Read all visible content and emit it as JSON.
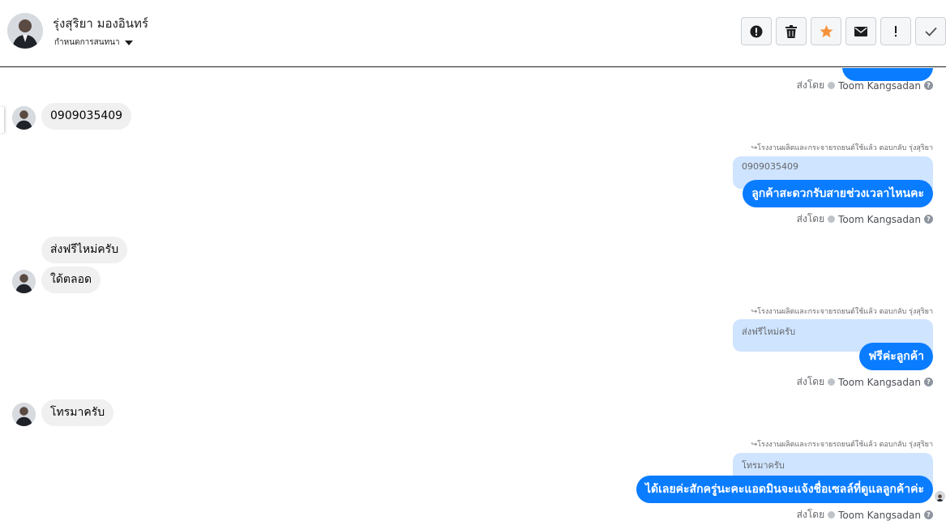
{
  "header": {
    "contact_name": "รุ่งสุริยา มองอินทร์",
    "convo_dropdown_label": "กำหนดการสนทนา",
    "toolbar": [
      {
        "icon": "alert-circle-icon",
        "name": "mark-spam-button"
      },
      {
        "icon": "trash-icon",
        "name": "delete-button"
      },
      {
        "icon": "star-icon",
        "name": "star-button",
        "color": "#f7923b"
      },
      {
        "icon": "envelope-icon",
        "name": "mark-unread-button"
      },
      {
        "icon": "exclamation-icon",
        "name": "important-button"
      },
      {
        "icon": "checkmark-icon",
        "name": "mark-done-button"
      }
    ]
  },
  "colors": {
    "outgoing_bubble": "#0a7cff",
    "incoming_bubble": "#f0f0f0",
    "quoted_bubble": "#cfe4ff"
  },
  "sent_by": {
    "prefix": "ส่งโดย",
    "agent": "Toom Kangsadan"
  },
  "messages": [
    {
      "direction": "incoming",
      "text": "0909035409"
    },
    {
      "direction": "outgoing",
      "reply_note": "โรงงานผลิตและกระจายรถยนต์ใช้แล้ว ตอบกลับ รุ่งสุริยา",
      "quoted": "0909035409",
      "text": "ลูกค้าสะดวกรับสายช่วงเวลาไหนคะ"
    },
    {
      "direction": "incoming",
      "text": "ส่งฟรีไหม่ครับ"
    },
    {
      "direction": "incoming",
      "text": "ใด้ตลอด"
    },
    {
      "direction": "outgoing",
      "reply_note": "โรงงานผลิตและกระจายรถยนต์ใช้แล้ว ตอบกลับ รุ่งสุริยา",
      "quoted": "ส่งฟรีไหม่ครับ",
      "text": "ฟรีค่ะลูกค้า"
    },
    {
      "direction": "incoming",
      "text": "โทรมาครับ"
    },
    {
      "direction": "outgoing",
      "reply_note": "โรงงานผลิตและกระจายรถยนต์ใช้แล้ว ตอบกลับ รุ่งสุริยา",
      "quoted": "โทรมาครับ",
      "text": "ได้เลยค่ะสักครู่นะคะแอดมินจะแจ้งชื่อเซลล์ที่ดูแลลูกค้าค่ะ"
    }
  ]
}
